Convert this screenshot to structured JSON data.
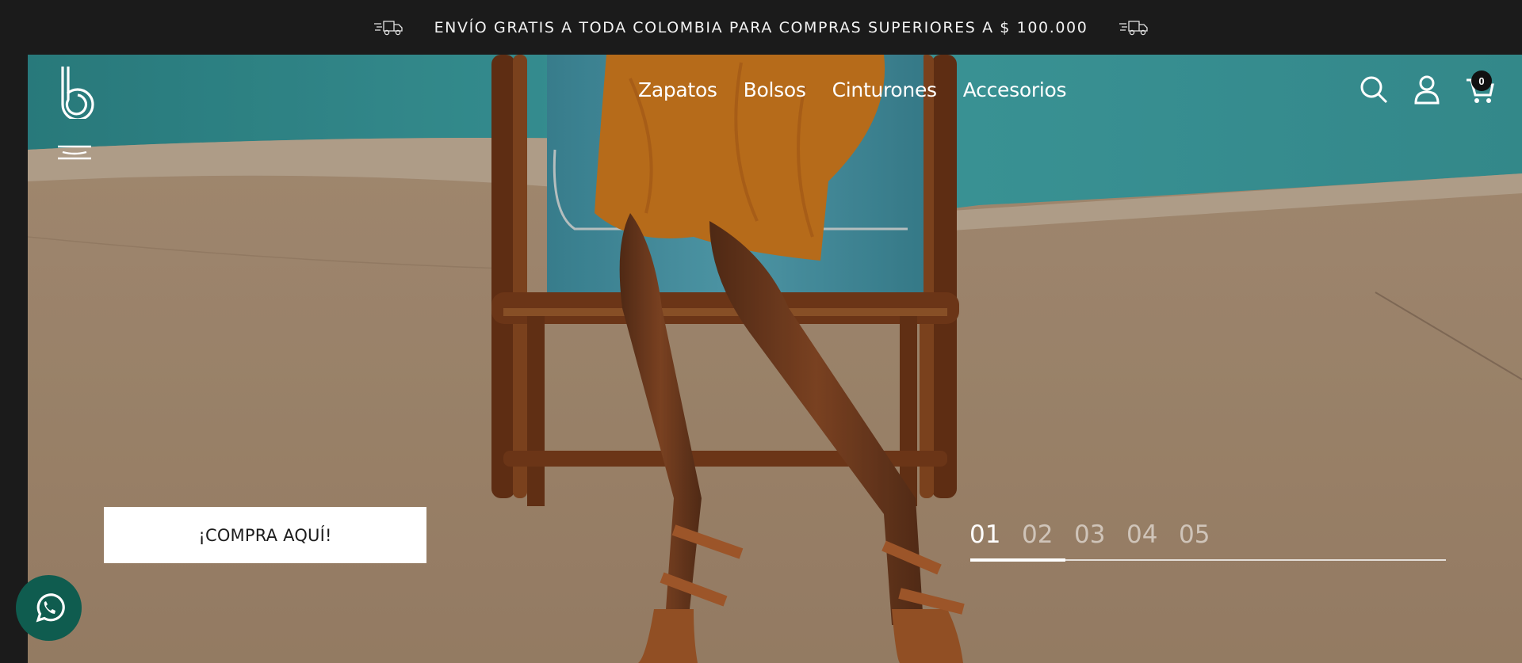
{
  "announcement": {
    "text": "ENVÍO GRATIS A TODA COLOMBIA PARA COMPRAS SUPERIORES A $ 100.000",
    "left_icon": "delivery-truck-icon",
    "right_icon": "delivery-truck-icon"
  },
  "header": {
    "logo_icon": "brand-b-logo",
    "menu_icon": "hamburger-menu-icon",
    "nav": [
      {
        "label": "Zapatos"
      },
      {
        "label": "Bolsos"
      },
      {
        "label": "Cinturones"
      },
      {
        "label": "Accesorios"
      }
    ],
    "icons": [
      "search-icon",
      "account-icon",
      "cart-icon"
    ],
    "cart_count": "0"
  },
  "hero": {
    "cta_label": "¡COMPRA AQUÍ!",
    "slides": [
      "01",
      "02",
      "03",
      "04",
      "05"
    ],
    "active_slide": "01",
    "progress_fraction": 0.2
  },
  "whatsapp": {
    "icon": "whatsapp-icon"
  },
  "colors": {
    "announcement_bg": "#1b1b1b",
    "whatsapp_bg": "#0f5c4f",
    "cta_bg": "#ffffff",
    "dress": "#d9821f",
    "pool": "#3aa3a3"
  }
}
